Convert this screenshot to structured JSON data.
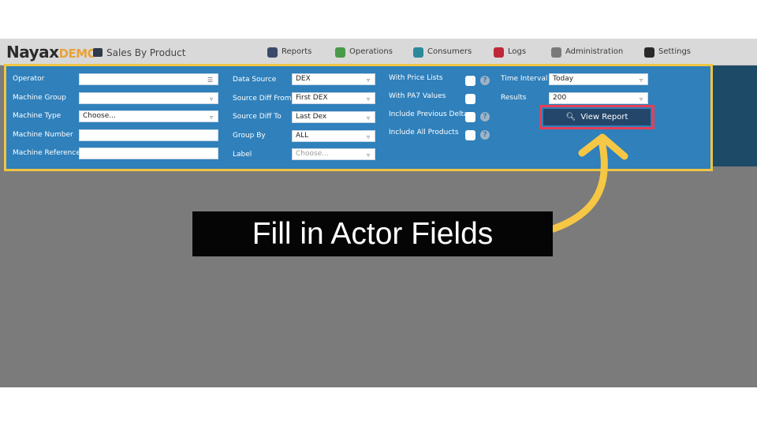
{
  "header": {
    "brand_main": "Nayax",
    "brand_sub": "DEMO",
    "page_title": "Sales By Product",
    "nav": [
      {
        "label": "Reports",
        "icon": "reports-icon",
        "color": "#3a4a6a"
      },
      {
        "label": "Operations",
        "icon": "operations-icon",
        "color": "#4a9a4a"
      },
      {
        "label": "Consumers",
        "icon": "consumers-icon",
        "color": "#2a8a9a"
      },
      {
        "label": "Logs",
        "icon": "logs-icon",
        "color": "#c0283a"
      },
      {
        "label": "Administration",
        "icon": "administration-icon",
        "color": "#7a7a7a"
      },
      {
        "label": "Settings",
        "icon": "settings-icon",
        "color": "#2a2a2a"
      }
    ]
  },
  "filters": {
    "col1": {
      "operator": {
        "label": "Operator",
        "value": ""
      },
      "machine_group": {
        "label": "Machine Group",
        "value": ""
      },
      "machine_type": {
        "label": "Machine Type",
        "value": "Choose..."
      },
      "machine_number": {
        "label": "Machine Number",
        "value": ""
      },
      "machine_reference": {
        "label": "Machine Reference",
        "value": ""
      }
    },
    "col2": {
      "data_source": {
        "label": "Data Source",
        "value": "DEX"
      },
      "source_diff_from": {
        "label": "Source Diff From",
        "value": "First DEX"
      },
      "source_diff_to": {
        "label": "Source Diff To",
        "value": "Last Dex"
      },
      "group_by": {
        "label": "Group By",
        "value": "ALL"
      },
      "label": {
        "label": "Label",
        "placeholder": "Choose..."
      }
    },
    "col3": {
      "with_price_lists": {
        "label": "With Price Lists"
      },
      "with_pa7_values": {
        "label": "With PA7 Values"
      },
      "include_previous_delta": {
        "label": "Include Previous Delta"
      },
      "include_all_products": {
        "label": "Include All Products"
      },
      "help_glyph": "?"
    },
    "col4": {
      "time_interval": {
        "label": "Time Interval",
        "value": "Today"
      },
      "results": {
        "label": "Results",
        "value": "200"
      }
    },
    "view_report": "View Report",
    "caret_glyph": "▿",
    "list_glyph": "☰"
  },
  "overlay": {
    "callout_text": "Fill in Actor Fields",
    "arrow_color": "#f6c744",
    "highlight_color": "#e63e55",
    "panel_outline_color": "#f0c542"
  }
}
